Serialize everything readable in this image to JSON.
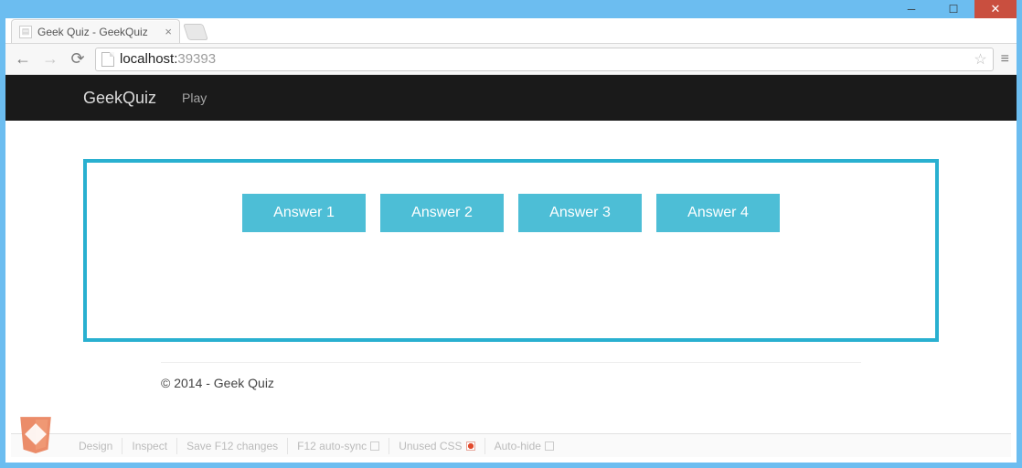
{
  "window": {
    "tab_title": "Geek Quiz - GeekQuiz",
    "address_host": "localhost:",
    "address_port": "39393"
  },
  "navbar": {
    "brand": "GeekQuiz",
    "links": [
      "Play"
    ]
  },
  "quiz": {
    "answers": [
      "Answer 1",
      "Answer 2",
      "Answer 3",
      "Answer 4"
    ]
  },
  "footer": {
    "text": "© 2014 - Geek Quiz"
  },
  "devtoolbar": {
    "items": [
      {
        "label": "Design",
        "checkbox": false
      },
      {
        "label": "Inspect",
        "checkbox": false
      },
      {
        "label": "Save F12 changes",
        "checkbox": false
      },
      {
        "label": "F12 auto-sync",
        "checkbox": true,
        "checked": false
      },
      {
        "label": "Unused CSS",
        "checkbox": true,
        "checked": true
      },
      {
        "label": "Auto-hide",
        "checkbox": true,
        "checked": false
      }
    ]
  }
}
